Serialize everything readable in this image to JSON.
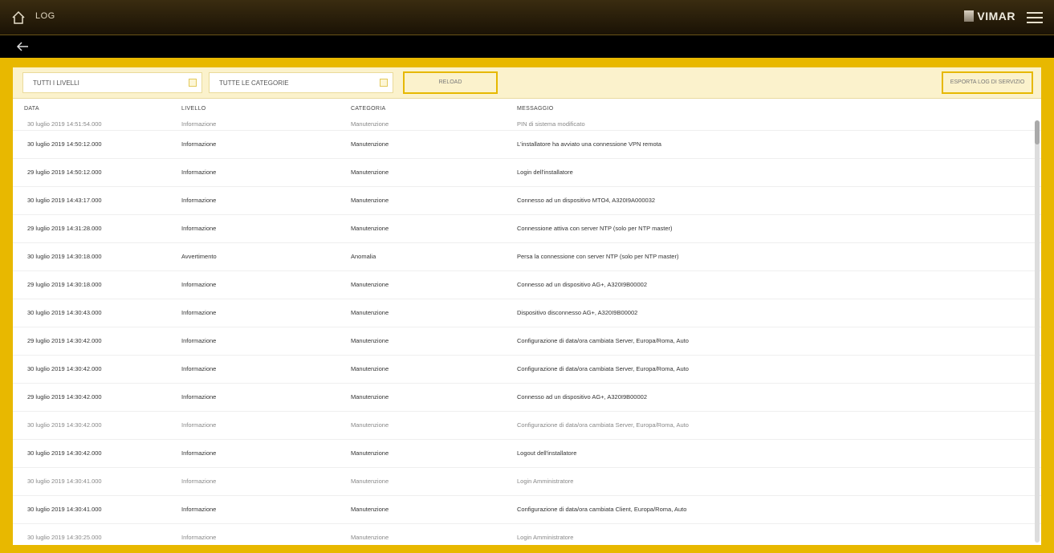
{
  "header": {
    "title": "LOG",
    "brand": "VIMAR",
    "home_icon": "home-icon",
    "menu_icon": "menu-icon"
  },
  "subbar": {
    "back_icon": "back-arrow-icon"
  },
  "filters": {
    "level_select": "TUTTI I LIVELLI",
    "category_select": "TUTTE LE CATEGORIE",
    "refresh_button": "RELOAD",
    "export_button": "ESPORTA LOG DI SERVIZIO"
  },
  "columns": [
    "DATA",
    "LIVELLO",
    "CATEGORIA",
    "MESSAGGIO"
  ],
  "rows": [
    {
      "data": "30 luglio 2019 14:51:54.000",
      "livello": "Informazione",
      "categoria": "Manutenzione",
      "messaggio": "PIN di sistema modificato"
    },
    {
      "data": "30 luglio 2019 14:50:12.000",
      "livello": "Informazione",
      "categoria": "Manutenzione",
      "messaggio": "L'installatore ha avviato una connessione VPN remota"
    },
    {
      "data": "29 luglio 2019 14:50:12.000",
      "livello": "Informazione",
      "categoria": "Manutenzione",
      "messaggio": "Login dell'installatore"
    },
    {
      "data": "30 luglio 2019 14:43:17.000",
      "livello": "Informazione",
      "categoria": "Manutenzione",
      "messaggio": "Connesso ad un dispositivo MTO4, A320I9A000032"
    },
    {
      "data": "29 luglio 2019 14:31:28.000",
      "livello": "Informazione",
      "categoria": "Manutenzione",
      "messaggio": "Connessione attiva con server NTP (solo per NTP master)"
    },
    {
      "data": "30 luglio 2019 14:30:18.000",
      "livello": "Avvertimento",
      "categoria": "Anomalia",
      "messaggio": "Persa la connessione con server NTP (solo per NTP master)"
    },
    {
      "data": "29 luglio 2019 14:30:18.000",
      "livello": "Informazione",
      "categoria": "Manutenzione",
      "messaggio": "Connesso ad un dispositivo AG+, A320I9B00002"
    },
    {
      "data": "30 luglio 2019 14:30:43.000",
      "livello": "Informazione",
      "categoria": "Manutenzione",
      "messaggio": "Dispositivo disconnesso AG+, A320I9B00002"
    },
    {
      "data": "29 luglio 2019 14:30:42.000",
      "livello": "Informazione",
      "categoria": "Manutenzione",
      "messaggio": "Configurazione di data/ora cambiata Server, Europa/Roma, Auto"
    },
    {
      "data": "30 luglio 2019 14:30:42.000",
      "livello": "Informazione",
      "categoria": "Manutenzione",
      "messaggio": "Configurazione di data/ora cambiata Server, Europa/Roma, Auto"
    },
    {
      "data": "29 luglio 2019 14:30:42.000",
      "livello": "Informazione",
      "categoria": "Manutenzione",
      "messaggio": "Connesso ad un dispositivo AG+, A320I9B00002"
    },
    {
      "data": "30 luglio 2019 14:30:42.000",
      "livello": "Informazione",
      "categoria": "Manutenzione",
      "messaggio": "Configurazione di data/ora cambiata Server, Europa/Roma, Auto"
    },
    {
      "data": "30 luglio 2019 14:30:42.000",
      "livello": "Informazione",
      "categoria": "Manutenzione",
      "messaggio": "Logout dell'installatore"
    },
    {
      "data": "30 luglio 2019 14:30:41.000",
      "livello": "Informazione",
      "categoria": "Manutenzione",
      "messaggio": "Login Amministratore"
    },
    {
      "data": "30 luglio 2019 14:30:41.000",
      "livello": "Informazione",
      "categoria": "Manutenzione",
      "messaggio": "Configurazione di data/ora cambiata Client, Europa/Roma, Auto"
    },
    {
      "data": "30 luglio 2019 14:30:25.000",
      "livello": "Informazione",
      "categoria": "Manutenzione",
      "messaggio": "Login Amministratore"
    }
  ]
}
